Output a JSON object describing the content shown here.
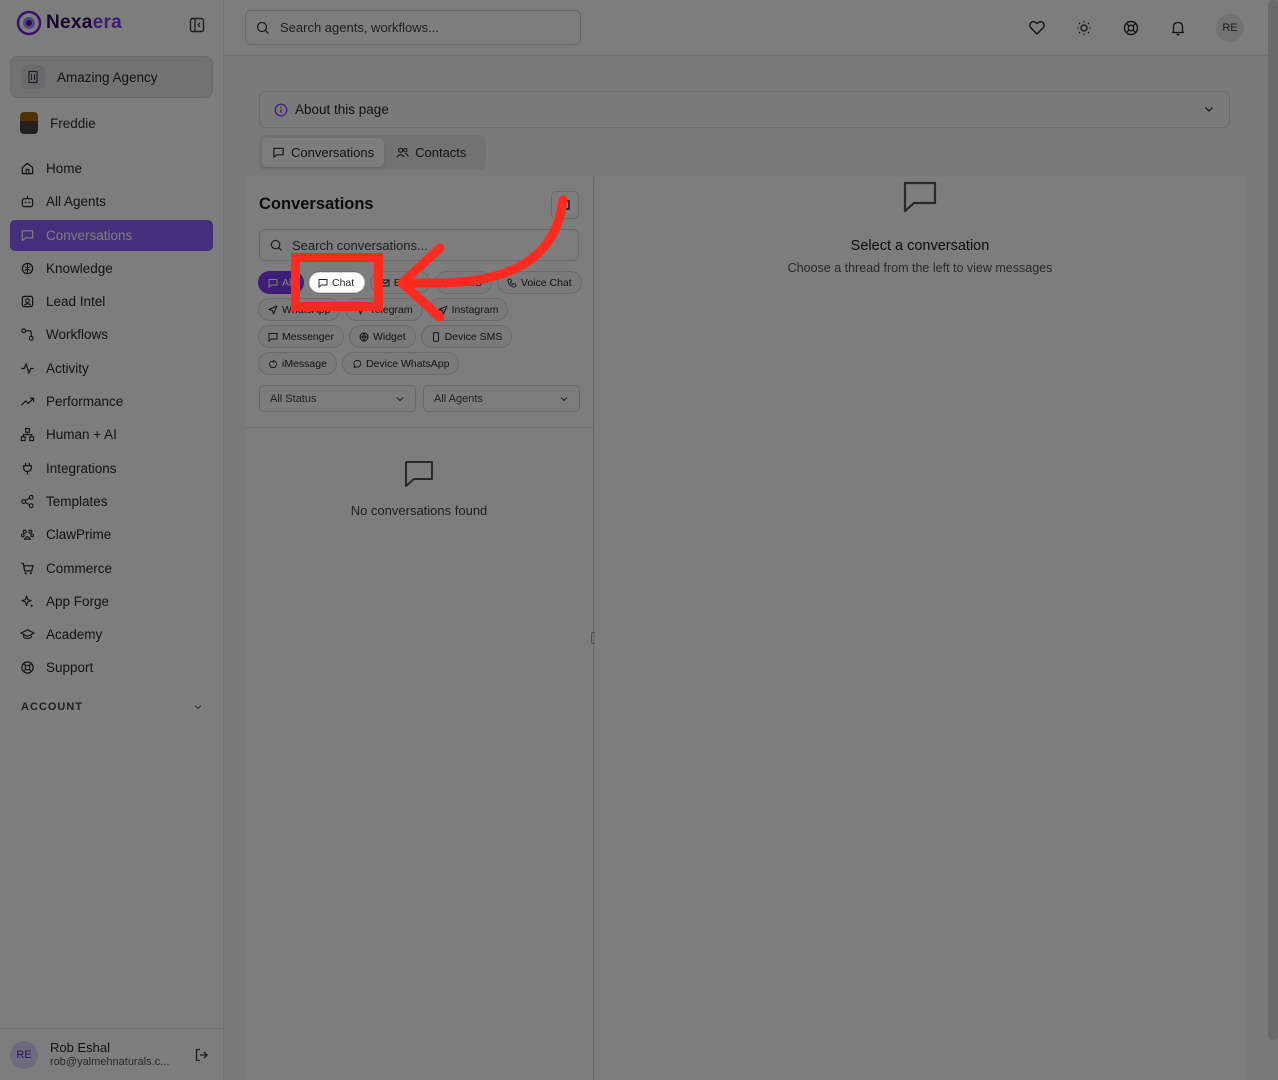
{
  "app": {
    "brand_prefix": "Nexa",
    "brand_suffix": "era",
    "agency": "Amazing Agency",
    "user_name": "Freddie"
  },
  "topbar": {
    "search_placeholder": "Search agents, workflows...",
    "avatar_initials": "RE"
  },
  "sidebar": {
    "items": [
      {
        "label": "Home",
        "icon": "home-icon"
      },
      {
        "label": "All Agents",
        "icon": "bot-icon"
      },
      {
        "label": "Conversations",
        "icon": "message-square-icon",
        "active": true
      },
      {
        "label": "Knowledge",
        "icon": "brain-icon"
      },
      {
        "label": "Lead Intel",
        "icon": "contact-card-icon"
      },
      {
        "label": "Workflows",
        "icon": "workflow-icon"
      },
      {
        "label": "Activity",
        "icon": "activity-icon"
      },
      {
        "label": "Performance",
        "icon": "trending-up-icon"
      },
      {
        "label": "Human + AI",
        "icon": "network-icon"
      },
      {
        "label": "Integrations",
        "icon": "plug-icon"
      },
      {
        "label": "Templates",
        "icon": "share-icon"
      },
      {
        "label": "ClawPrime",
        "icon": "paw-icon"
      },
      {
        "label": "Commerce",
        "icon": "cart-icon"
      },
      {
        "label": "App Forge",
        "icon": "sparkles-icon"
      },
      {
        "label": "Academy",
        "icon": "graduation-cap-icon"
      },
      {
        "label": "Support",
        "icon": "lifebuoy-icon"
      }
    ],
    "account_label": "ACCOUNT",
    "footer": {
      "initials": "RE",
      "name": "Rob Eshal",
      "email": "rob@yalmehnaturals.c..."
    }
  },
  "about": {
    "label": "About this page"
  },
  "tabs": [
    {
      "label": "Conversations",
      "active": true
    },
    {
      "label": "Contacts",
      "active": false
    }
  ],
  "conversations": {
    "title": "Conversations",
    "search_placeholder": "Search conversations...",
    "chips": [
      {
        "label": "All",
        "active": true
      },
      {
        "label": "Chat",
        "highlighted": true
      },
      {
        "label": "Email"
      },
      {
        "label": "SMS"
      },
      {
        "label": "Voice Chat"
      },
      {
        "label": "WhatsApp"
      },
      {
        "label": "Telegram"
      },
      {
        "label": "Instagram"
      },
      {
        "label": "Messenger"
      },
      {
        "label": "Widget"
      },
      {
        "label": "Device SMS"
      },
      {
        "label": "iMessage"
      },
      {
        "label": "Device WhatsApp"
      }
    ],
    "status_select": "All Status",
    "agent_select": "All Agents",
    "empty_text": "No conversations found"
  },
  "detail": {
    "title": "Select a conversation",
    "subtitle": "Choose a thread from the left to view messages"
  },
  "colors": {
    "accent": "#7c3aed",
    "annotation": "#ff2a1f"
  }
}
